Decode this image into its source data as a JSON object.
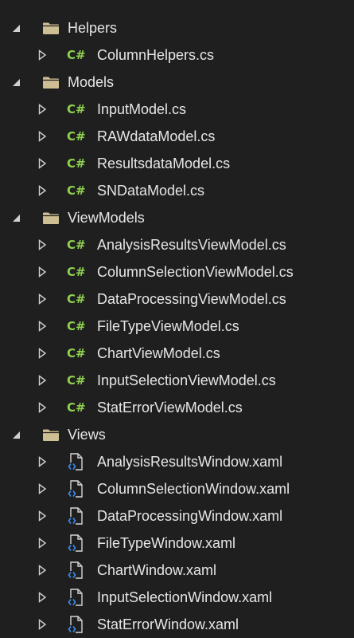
{
  "folders": [
    {
      "name": "Helpers",
      "files": [
        {
          "name": "ColumnHelpers.cs",
          "type": "cs"
        }
      ]
    },
    {
      "name": "Models",
      "files": [
        {
          "name": "InputModel.cs",
          "type": "cs"
        },
        {
          "name": "RAWdataModel.cs",
          "type": "cs"
        },
        {
          "name": "ResultsdataModel.cs",
          "type": "cs"
        },
        {
          "name": "SNDataModel.cs",
          "type": "cs"
        }
      ]
    },
    {
      "name": "ViewModels",
      "files": [
        {
          "name": "AnalysisResultsViewModel.cs",
          "type": "cs"
        },
        {
          "name": "ColumnSelectionViewModel.cs",
          "type": "cs"
        },
        {
          "name": "DataProcessingViewModel.cs",
          "type": "cs"
        },
        {
          "name": "FileTypeViewModel.cs",
          "type": "cs"
        },
        {
          "name": "ChartViewModel.cs",
          "type": "cs"
        },
        {
          "name": "InputSelectionViewModel.cs",
          "type": "cs"
        },
        {
          "name": "StatErrorViewModel.cs",
          "type": "cs"
        }
      ]
    },
    {
      "name": "Views",
      "files": [
        {
          "name": "AnalysisResultsWindow.xaml",
          "type": "xaml"
        },
        {
          "name": "ColumnSelectionWindow.xaml",
          "type": "xaml"
        },
        {
          "name": "DataProcessingWindow.xaml",
          "type": "xaml"
        },
        {
          "name": "FileTypeWindow.xaml",
          "type": "xaml"
        },
        {
          "name": "ChartWindow.xaml",
          "type": "xaml"
        },
        {
          "name": "InputSelectionWindow.xaml",
          "type": "xaml"
        },
        {
          "name": "StatErrorWindow.xaml",
          "type": "xaml"
        }
      ]
    }
  ],
  "icons": {
    "cs_glyph": "C#",
    "folder": "folder-icon",
    "xaml": "xaml-file-icon",
    "expanded": "expanded-triangle-icon",
    "collapsed": "collapsed-triangle-icon"
  },
  "colors": {
    "background": "#1f1f1f",
    "text": "#e6e6e6",
    "csharp": "#8fd14f",
    "folder": "#d8c79a",
    "arrow": "#d0d0d0"
  }
}
